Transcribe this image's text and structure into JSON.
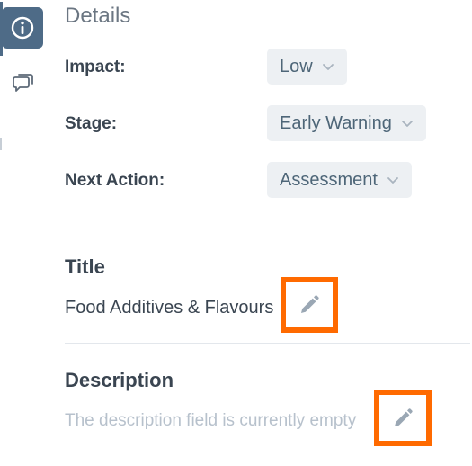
{
  "colors": {
    "rail_active_bg": "#4e6b87",
    "rail_accent": "#4e6b87",
    "pill_bg": "#edf0f3",
    "pill_text": "#4e6678",
    "highlight": "#ff6a00",
    "pencil": "#9aa7b4",
    "icon_muted": "#5d6a78"
  },
  "sidebar": {
    "items": [
      {
        "icon": "info-icon",
        "active": true
      },
      {
        "icon": "comments-icon",
        "active": false
      }
    ]
  },
  "details": {
    "title": "Details",
    "fields": [
      {
        "label": "Impact:",
        "value": "Low"
      },
      {
        "label": "Stage:",
        "value": "Early Warning"
      },
      {
        "label": "Next Action:",
        "value": "Assessment"
      }
    ]
  },
  "title_section": {
    "heading": "Title",
    "value": "Food Additives & Flavours",
    "edit_icon": "pencil-icon"
  },
  "description_section": {
    "heading": "Description",
    "placeholder": "The description field is currently empty",
    "edit_icon": "pencil-icon"
  }
}
